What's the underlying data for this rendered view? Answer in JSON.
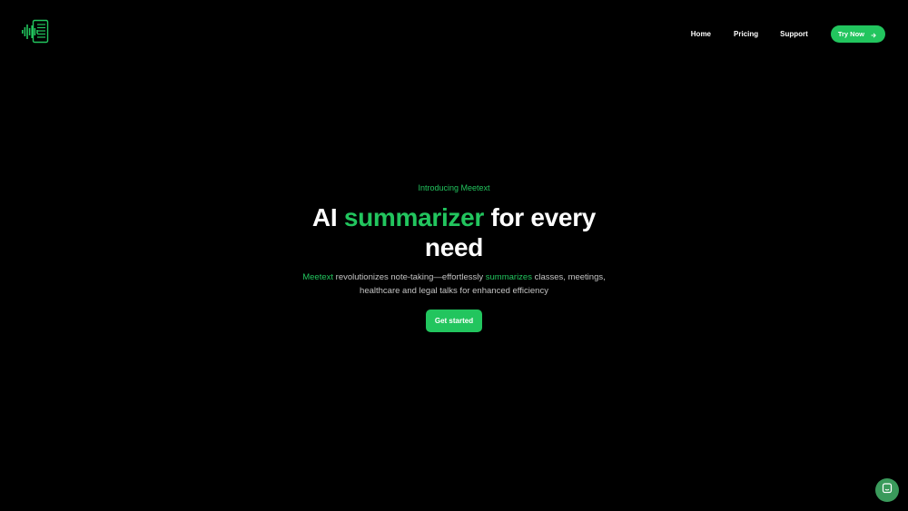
{
  "brand": {
    "logo_icon": "soundwave-document-icon",
    "accent_color": "#22c55e",
    "background_color": "#000000"
  },
  "nav": {
    "home": "Home",
    "pricing": "Pricing",
    "support": "Support",
    "try_now": "Try Now",
    "try_now_icon": "arrow-right-icon"
  },
  "hero": {
    "eyebrow": "Introducing Meetext",
    "headline_prefix": "AI ",
    "headline_accent": "summarizer",
    "headline_suffix": " for every need",
    "sub_accent_1": "Meetext",
    "sub_text_1": " revolutionizes note-taking—effortlessly ",
    "sub_accent_2": "summarizes",
    "sub_text_2": " classes, meetings, healthcare and legal talks for enhanced efficiency",
    "cta": "Get started"
  },
  "chat": {
    "icon": "chat-icon",
    "color": "#3a9a5b"
  }
}
